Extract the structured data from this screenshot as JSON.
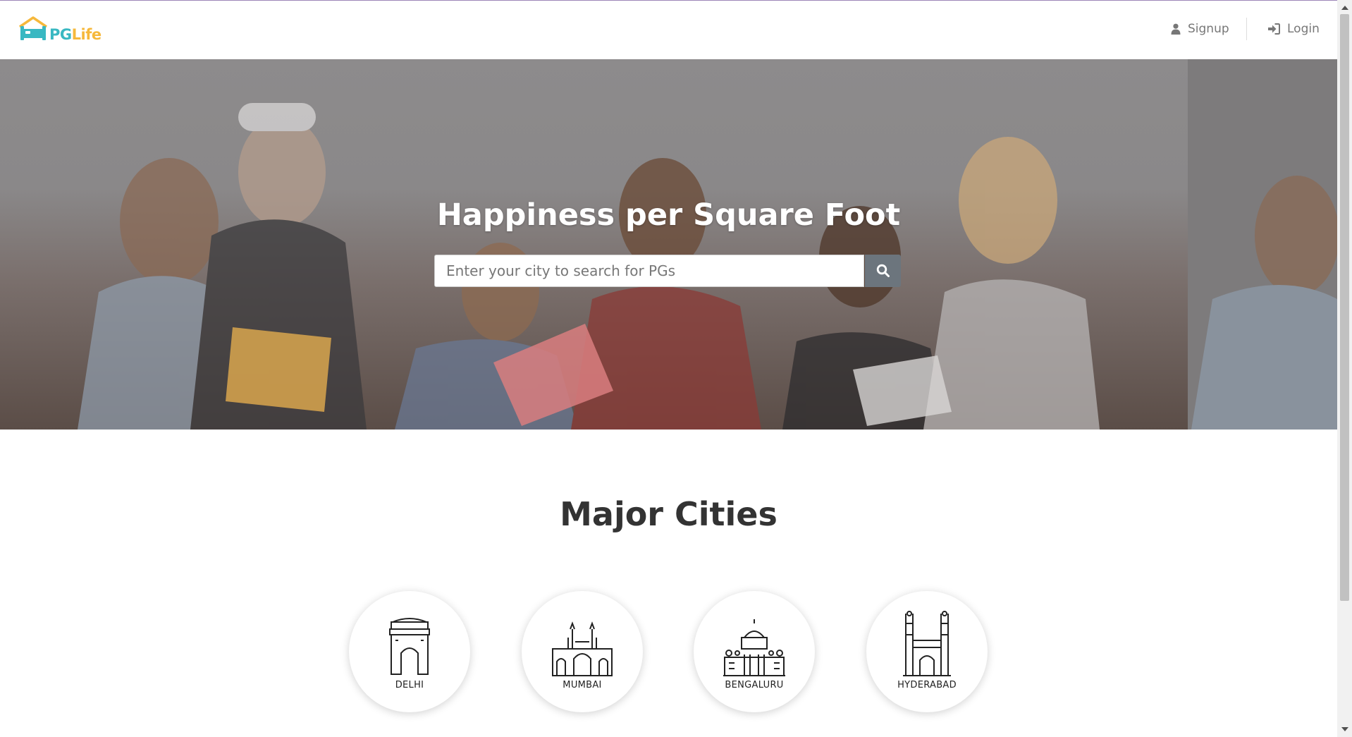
{
  "header": {
    "logo": {
      "part1": "PG",
      "part2": "Life"
    },
    "nav": {
      "signup_label": "Signup",
      "login_label": "Login"
    }
  },
  "hero": {
    "title": "Happiness per Square Foot",
    "search": {
      "placeholder": "Enter your city to search for PGs",
      "value": ""
    }
  },
  "cities": {
    "title": "Major Cities",
    "items": [
      {
        "label": "DELHI",
        "icon": "india-gate-icon"
      },
      {
        "label": "MUMBAI",
        "icon": "gateway-of-india-icon"
      },
      {
        "label": "BENGALURU",
        "icon": "vidhana-soudha-icon"
      },
      {
        "label": "HYDERABAD",
        "icon": "charminar-icon"
      }
    ]
  },
  "colors": {
    "brand_teal": "#39b8c2",
    "brand_yellow": "#f6b83b",
    "search_button": "#6c757d"
  }
}
